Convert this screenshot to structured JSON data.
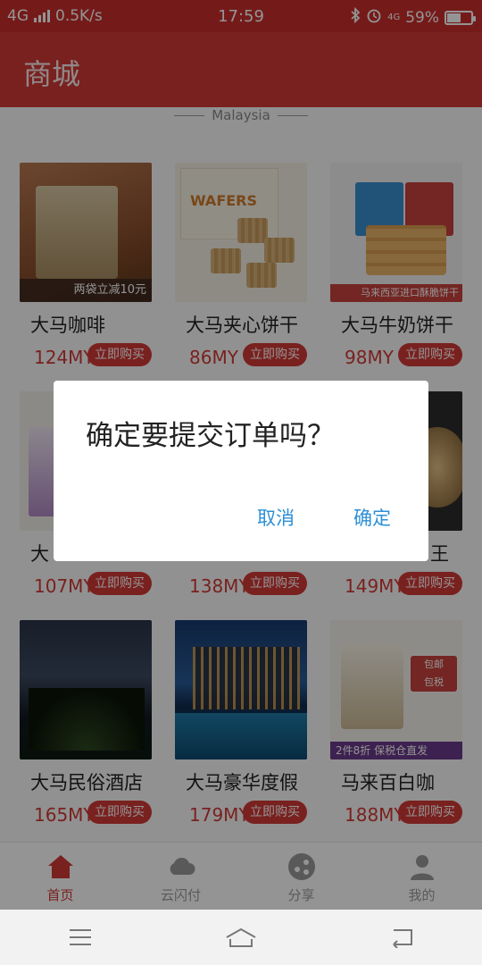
{
  "status_bar": {
    "network": "4G",
    "speed": "0.5K/s",
    "time": "17:59",
    "battery": "59%",
    "battery_level": 0.59
  },
  "header": {
    "title": "商城"
  },
  "section": {
    "label": "Malaysia"
  },
  "products": [
    {
      "name": "大马咖啡",
      "price": "124MY",
      "buy_label": "立即购买",
      "image_text": "两袋立减10元"
    },
    {
      "name": "大马夹心饼干",
      "price": "86MY",
      "buy_label": "立即购买",
      "image_text": "WAFERS"
    },
    {
      "name": "大马牛奶饼干",
      "price": "98MY",
      "buy_label": "立即购买",
      "image_text": "马来西亚进口酥脆饼干"
    },
    {
      "name": "大",
      "price": "107MY",
      "buy_label": "立即购买",
      "image_text": ""
    },
    {
      "name": "",
      "price": "138MY",
      "buy_label": "立即购买",
      "image_text": ""
    },
    {
      "name": "王",
      "price": "149MY",
      "buy_label": "立即购买",
      "image_text": ""
    },
    {
      "name": "大马民俗酒店",
      "price": "165MY",
      "buy_label": "立即购买",
      "image_text": ""
    },
    {
      "name": "大马豪华度假",
      "price": "179MY",
      "buy_label": "立即购买",
      "image_text": ""
    },
    {
      "name": "马来百白咖",
      "price": "188MY",
      "buy_label": "立即购买",
      "image_text": "2件8折 保税仓直发"
    }
  ],
  "dialog": {
    "message": "确定要提交订单吗？",
    "cancel_label": "取消",
    "confirm_label": "确定"
  },
  "tabs": [
    {
      "label": "首页",
      "icon": "home-icon",
      "active": true
    },
    {
      "label": "云闪付",
      "icon": "cloud-icon",
      "active": false
    },
    {
      "label": "分享",
      "icon": "share-icon",
      "active": false
    },
    {
      "label": "我的",
      "icon": "user-icon",
      "active": false
    }
  ],
  "colors": {
    "accent": "#d03a36",
    "dialog_button": "#2d8fd6"
  }
}
